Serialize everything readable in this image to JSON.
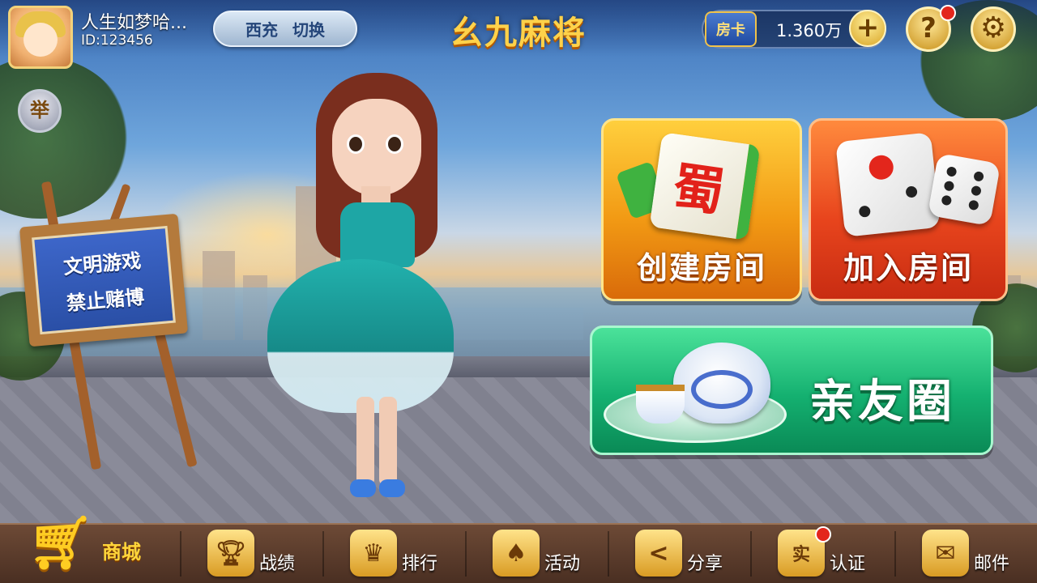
{
  "header": {
    "username": "人生如梦哈...",
    "user_id": "ID:123456",
    "region": {
      "name": "西充",
      "action": "切换"
    },
    "game_title": "幺九麻将",
    "room_card": {
      "label": "房卡",
      "count": "1.360万"
    },
    "plus_symbol": "+",
    "help_symbol": "?",
    "settings_symbol": "⚙",
    "report_label": "举"
  },
  "sign": {
    "line1": "文明游戏",
    "line2": "禁止赌博"
  },
  "menu": {
    "create_room": {
      "label": "创建房间",
      "tile_char": "蜀"
    },
    "join_room": {
      "label": "加入房间"
    },
    "friends_circle": {
      "label": "亲友圈"
    }
  },
  "bottom_nav": {
    "shop": {
      "label": "商城",
      "icon": "cart-icon"
    },
    "record": {
      "label": "战绩",
      "icon": "trophy-icon"
    },
    "ranking": {
      "label": "排行",
      "icon": "podium-icon"
    },
    "activity": {
      "label": "活动",
      "icon": "gift-icon"
    },
    "share": {
      "label": "分享",
      "icon": "share-icon"
    },
    "verify": {
      "label": "认证",
      "icon": "id-verify-icon",
      "badge": "实"
    },
    "mail": {
      "label": "邮件",
      "icon": "mail-icon"
    }
  },
  "colors": {
    "accent_gold": "#ffd24a",
    "create_orange": "#f29a14",
    "join_red": "#e8451d",
    "friends_green": "#14b070",
    "notification_red": "#e3261c"
  }
}
